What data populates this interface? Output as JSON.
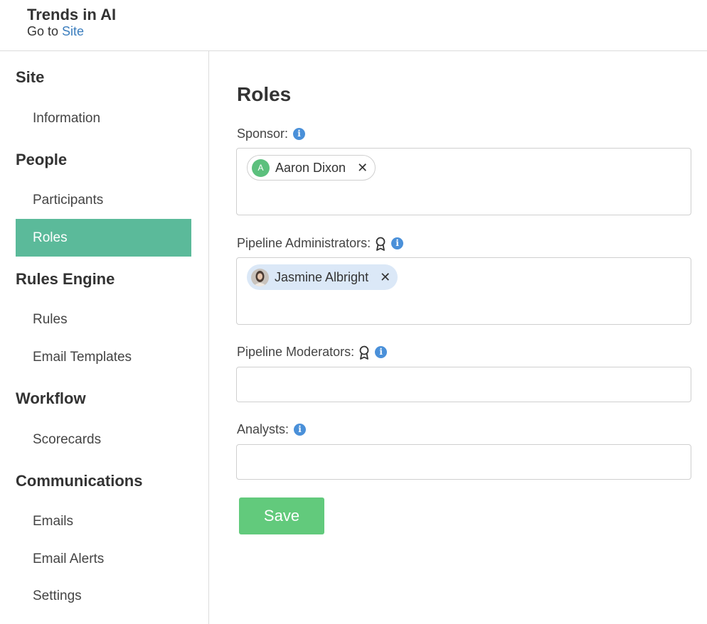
{
  "header": {
    "site_title": "Trends in AI",
    "goto_prefix": "Go to",
    "goto_link": "Site"
  },
  "sidebar": {
    "sections": [
      {
        "title": "Site",
        "items": [
          "Information"
        ]
      },
      {
        "title": "People",
        "items": [
          "Participants",
          "Roles"
        ]
      },
      {
        "title": "Rules Engine",
        "items": [
          "Rules",
          "Email Templates"
        ]
      },
      {
        "title": "Workflow",
        "items": [
          "Scorecards"
        ]
      },
      {
        "title": "Communications",
        "items": [
          "Emails",
          "Email Alerts",
          "Settings"
        ]
      }
    ],
    "active_item": "Roles"
  },
  "main": {
    "title": "Roles",
    "fields": {
      "sponsor": {
        "label": "Sponsor:",
        "chips": [
          {
            "name": "Aaron Dixon",
            "initial": "A"
          }
        ]
      },
      "pipeline_admins": {
        "label": "Pipeline Administrators:",
        "chips": [
          {
            "name": "Jasmine Albright"
          }
        ]
      },
      "pipeline_moderators": {
        "label": "Pipeline Moderators:",
        "chips": []
      },
      "analysts": {
        "label": "Analysts:",
        "chips": []
      }
    },
    "save_label": "Save"
  },
  "icons": {
    "info": "info-icon",
    "ribbon": "ribbon-icon",
    "remove": "close-icon"
  },
  "colors": {
    "active_nav": "#5bba9a",
    "save_button": "#62ca7c",
    "info_icon": "#4a90d9",
    "link": "#3b7dbd",
    "avatar_green": "#5cc07d",
    "chip_selected_bg": "#dbe8f7"
  }
}
